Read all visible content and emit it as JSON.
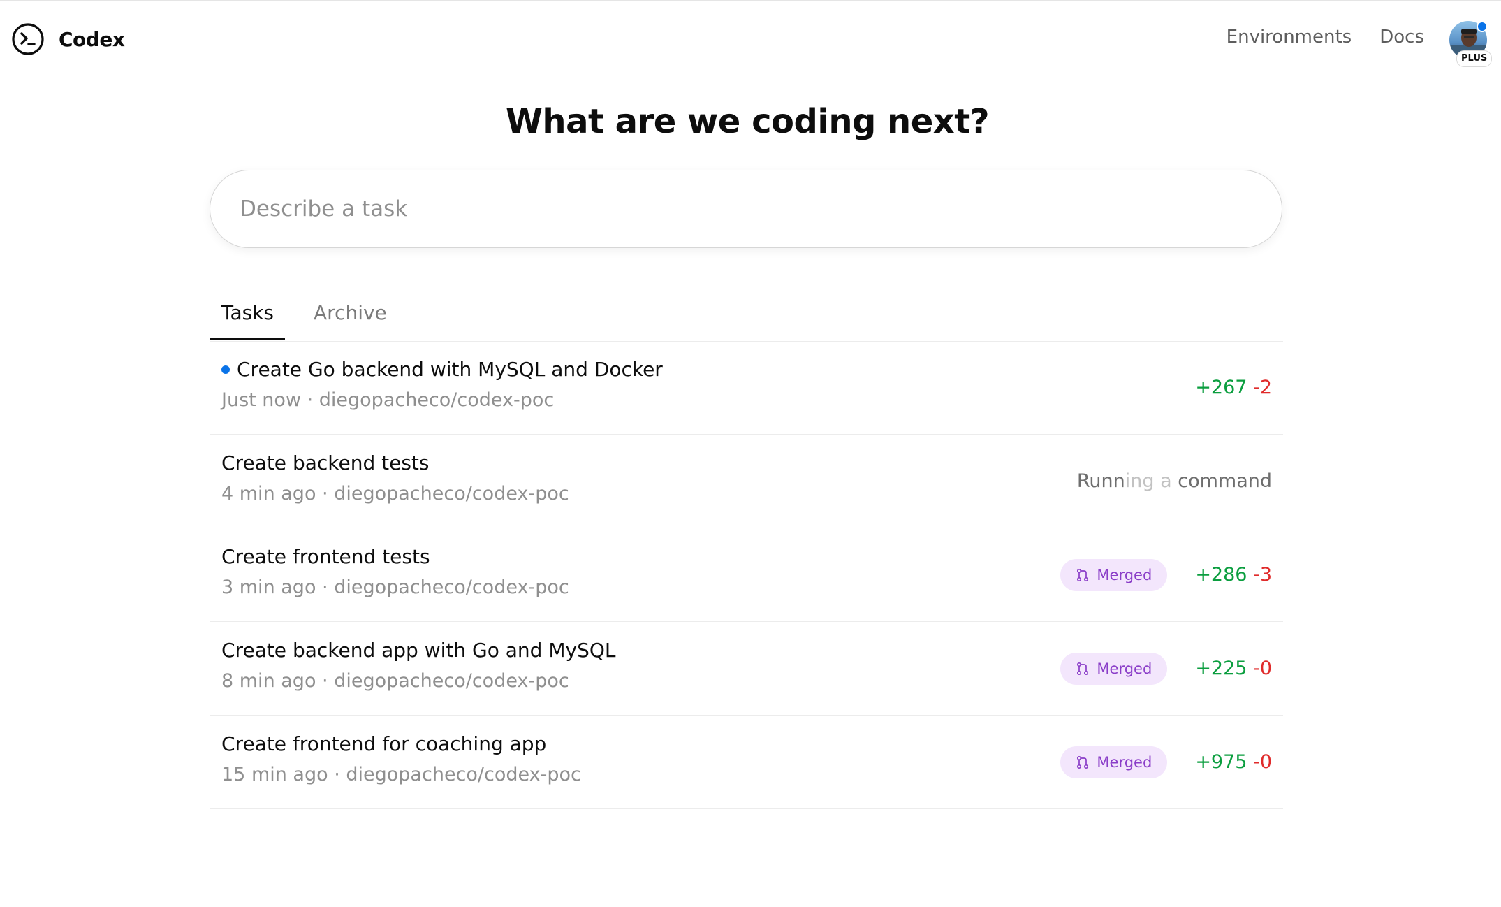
{
  "header": {
    "brand_name": "Codex",
    "nav": [
      {
        "label": "Environments"
      },
      {
        "label": "Docs"
      }
    ],
    "plan_badge": "PLUS"
  },
  "hero": {
    "title": "What are we coding next?",
    "input_placeholder": "Describe a task",
    "input_value": ""
  },
  "tabs": [
    {
      "label": "Tasks",
      "active": true
    },
    {
      "label": "Archive",
      "active": false
    }
  ],
  "tasks": [
    {
      "title": "Create Go backend with MySQL and Docker",
      "unread": true,
      "meta": "Just now · diegopacheco/codex-poc",
      "status": "",
      "additions": "+267",
      "deletions": "-2"
    },
    {
      "title": "Create backend tests",
      "unread": false,
      "meta": "4 min ago · diegopacheco/codex-poc",
      "status_parts": [
        "Runn",
        "ing a ",
        "command"
      ]
    },
    {
      "title": "Create frontend tests",
      "unread": false,
      "meta": "3 min ago · diegopacheco/codex-poc",
      "status": "Merged",
      "additions": "+286",
      "deletions": "-3"
    },
    {
      "title": "Create backend app with Go and MySQL",
      "unread": false,
      "meta": "8 min ago · diegopacheco/codex-poc",
      "status": "Merged",
      "additions": "+225",
      "deletions": "-0"
    },
    {
      "title": "Create frontend for coaching app",
      "unread": false,
      "meta": "15 min ago · diegopacheco/codex-poc",
      "status": "Merged",
      "additions": "+975",
      "deletions": "-0"
    }
  ],
  "colors": {
    "unread_dot": "#0a73e8",
    "additions": "#0b9e3f",
    "deletions": "#e02b2b",
    "merged_bg": "#f3e6fc",
    "merged_text": "#8a3dc8"
  }
}
